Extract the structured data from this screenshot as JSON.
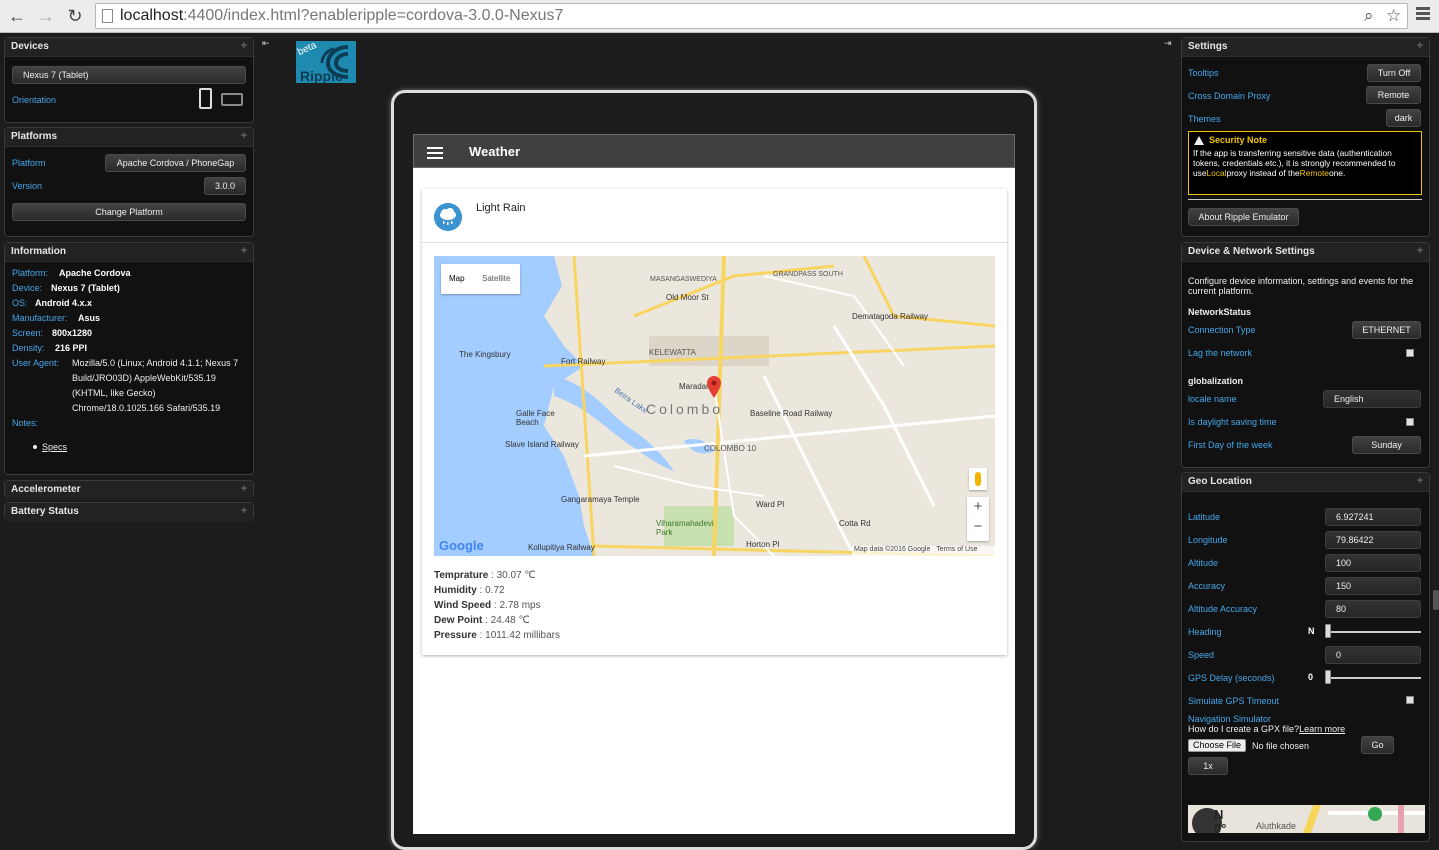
{
  "browser": {
    "url_host": "localhost",
    "url_rest": ":4400/index.html?enableripple=cordova-3.0.0-Nexus7"
  },
  "icons": {
    "back": "←",
    "forward": "→",
    "reload": "↻",
    "zoom": "⌕",
    "star": "☆",
    "expand": "+"
  },
  "devices": {
    "title": "Devices",
    "device": "Nexus 7 (Tablet)",
    "orientation_label": "Orientation"
  },
  "platforms": {
    "title": "Platforms",
    "platform_label": "Platform",
    "platform_value": "Apache Cordova / PhoneGap",
    "version_label": "Version",
    "version_value": "3.0.0",
    "change_button": "Change Platform"
  },
  "information": {
    "title": "Information",
    "rows": [
      {
        "label": "Platform:",
        "value": "Apache Cordova"
      },
      {
        "label": "Device:",
        "value": "Nexus 7 (Tablet)"
      },
      {
        "label": "OS:",
        "value": "Android 4.x.x"
      },
      {
        "label": "Manufacturer:",
        "value": "Asus"
      },
      {
        "label": "Screen:",
        "value": "800x1280"
      },
      {
        "label": "Density:",
        "value": "216 PPI"
      }
    ],
    "user_agent_label": "User Agent:",
    "user_agent_lines": [
      "Mozilla/5.0 (Linux; Android 4.1.1; Nexus 7",
      "Build/JRO03D) AppleWebKit/535.19",
      "(KHTML, like Gecko)",
      "Chrome/18.0.1025.166 Safari/535.19"
    ],
    "notes_label": "Notes:",
    "specs_link": "Specs"
  },
  "accelerometer": {
    "title": "Accelerometer"
  },
  "battery": {
    "title": "Battery Status"
  },
  "app": {
    "title": "Weather",
    "condition": "Light Rain",
    "map_tab": "Map",
    "satellite_tab": "Satellite",
    "map_city": "Colombo",
    "map_labels": [
      "Fort Railway",
      "The Kingsbury",
      "Galle Face Beach",
      "Slave Island Railway",
      "Maradana",
      "Baseline Road Railway",
      "Dematagoda Railway",
      "Gangaramaya Temple",
      "Kollupitiya Railway",
      "Horton Pl",
      "Cotta Rd",
      "Ward Pl",
      "GRANDPASS SOUTH",
      "MASANGASWEDIYA",
      "Old Moor St",
      "KELEWATTA",
      "COLOMBO 10",
      "Beira Lake",
      "Viharamahadevi Park"
    ],
    "map_footer": "Map data ©2016 Google",
    "map_terms": "Terms of Use",
    "google": "Google",
    "stats": [
      {
        "label": "Temprature",
        "value": " : 30.07 ℃"
      },
      {
        "label": "Humidity",
        "value": " : 0.72"
      },
      {
        "label": "Wind Speed",
        "value": " : 2.78 mps"
      },
      {
        "label": "Dew Point",
        "value": " : 24.48 ℃"
      },
      {
        "label": "Pressure",
        "value": " : 1011.42 millibars"
      }
    ]
  },
  "settings": {
    "title": "Settings",
    "tooltips_label": "Tooltips",
    "tooltips_value": "Turn Off",
    "proxy_label": "Cross Domain Proxy",
    "proxy_value": "Remote",
    "themes_label": "Themes",
    "themes_value": "dark",
    "note_title": "Security Note",
    "note_text_1": "If the app is transferring sensitive data (authentication tokens, credentials etc.), it is strongly recommended to use",
    "note_local": "Local",
    "note_text_2": "proxy instead of the",
    "note_remote": "Remote",
    "note_text_3": "one.",
    "about_button": "About Ripple Emulator"
  },
  "network": {
    "title": "Device & Network Settings",
    "intro": "Configure device information, settings and events for the current platform.",
    "network_heading": "NetworkStatus",
    "conn_label": "Connection Type",
    "conn_value": "ETHERNET",
    "lag_label": "Lag the network",
    "glob_heading": "globalization",
    "locale_label": "locale name",
    "locale_value": "English",
    "dst_label": "Is daylight saving time",
    "firstday_label": "First Day of the week",
    "firstday_value": "Sunday"
  },
  "geo": {
    "title": "Geo Location",
    "lat_label": "Latitude",
    "lat_value": "6.927241",
    "lon_label": "Longitude",
    "lon_value": "79.86422",
    "alt_label": "Altitude",
    "alt_value": "100",
    "acc_label": "Accuracy",
    "acc_value": "150",
    "altacc_label": "Altitude Accuracy",
    "altacc_value": "80",
    "heading_label": "Heading",
    "heading_value": "N",
    "speed_label": "Speed",
    "speed_value": "0",
    "gpsdelay_label": "GPS Delay (seconds)",
    "gpsdelay_value": "0",
    "timeout_label": "Simulate GPS Timeout",
    "navsim_label": "Navigation Simulator",
    "gpx_question": "How do I create a GPX file?",
    "learn_more": "Learn more",
    "choose_file": "Choose File",
    "no_file": "No file chosen",
    "go_button": "Go",
    "rate_button": "1x",
    "compass_n": "N",
    "compass_deg": "0°",
    "map_street": "Aluthkade"
  }
}
